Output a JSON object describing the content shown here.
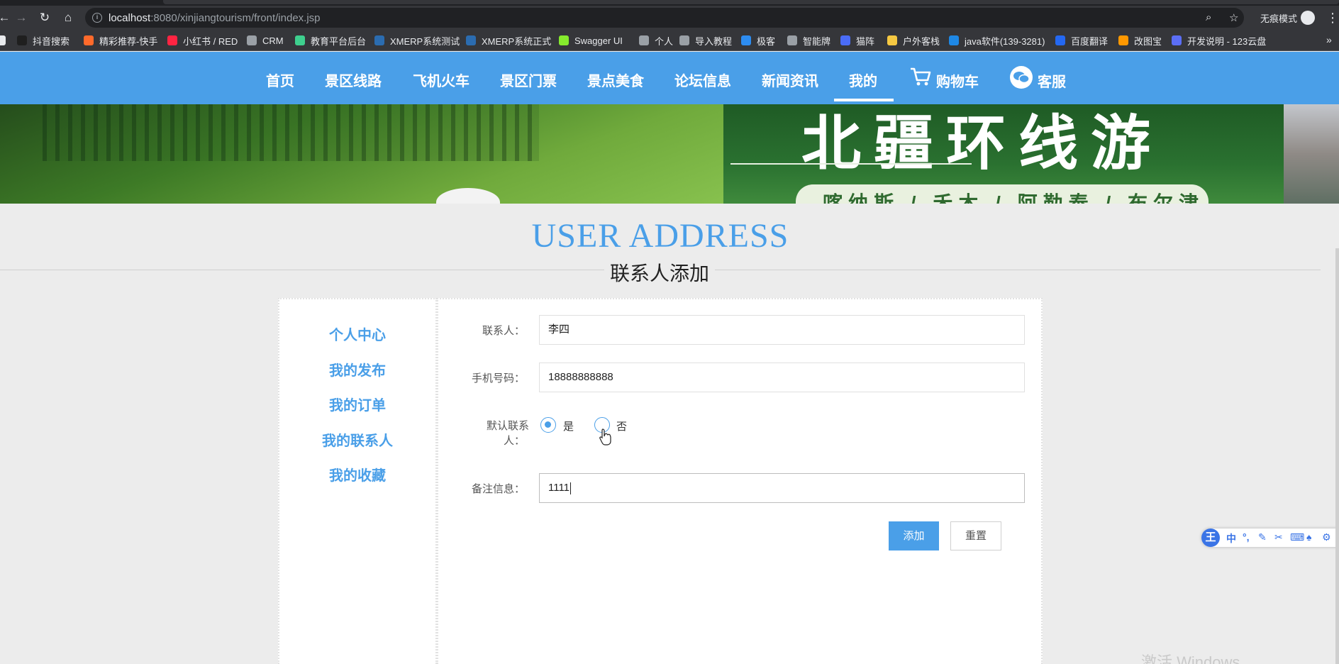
{
  "browser": {
    "url_host": "localhost",
    "url_path": ":8080/xinjiangtourism/front/index.jsp",
    "incognito_label": "无痕模式",
    "bookmarks": [
      {
        "label": "抖音搜索",
        "color": "#1f1f1f"
      },
      {
        "label": "精彩推荐-快手",
        "color": "#ff6a2b"
      },
      {
        "label": "小红书 / RED",
        "color": "#ff2442"
      },
      {
        "label": "CRM",
        "color": "#9aa0a6"
      },
      {
        "label": "教育平台后台",
        "color": "#3ecf8e"
      },
      {
        "label": "XMERP系统测试",
        "color": "#2b6cb0"
      },
      {
        "label": "XMERP系统正式",
        "color": "#2b6cb0"
      },
      {
        "label": "Swagger UI",
        "color": "#85ea2d"
      },
      {
        "label": "个人",
        "color": "#9aa0a6"
      },
      {
        "label": "导入教程",
        "color": "#9aa0a6"
      },
      {
        "label": "极客",
        "color": "#2d8cf0"
      },
      {
        "label": "智能牌",
        "color": "#9aa0a6"
      },
      {
        "label": "猫阵",
        "color": "#4a6cf7"
      },
      {
        "label": "户外客栈",
        "color": "#f5c842"
      },
      {
        "label": "java软件(139-3281)",
        "color": "#1e88e5"
      },
      {
        "label": "百度翻译",
        "color": "#2468f2"
      },
      {
        "label": "改图宝",
        "color": "#ff9800"
      },
      {
        "label": "开发说明 - 123云盘",
        "color": "#5b6ef5"
      }
    ]
  },
  "nav": {
    "items": [
      "首页",
      "景区线路",
      "飞机火车",
      "景区门票",
      "景点美食",
      "论坛信息",
      "新闻资讯",
      "我的"
    ],
    "active": "我的",
    "cart": "购物车",
    "service": "客服"
  },
  "banner": {
    "title": "北疆环线游",
    "subtitle": "喀纳斯 / 禾木 / 阿勒泰 / 布尔津"
  },
  "section": {
    "title_en": "USER ADDRESS",
    "title_cn": "联系人添加"
  },
  "sidebar": {
    "items": [
      "个人中心",
      "我的发布",
      "我的订单",
      "我的联系人",
      "我的收藏"
    ]
  },
  "form": {
    "contact_label": "联系人：",
    "contact_value": "李四",
    "phone_label": "手机号码：",
    "phone_value": "18888888888",
    "default_label_line1": "默认联系",
    "default_label_line2": "人：",
    "default_yes": "是",
    "default_no": "否",
    "default_selected": "是",
    "remark_label": "备注信息：",
    "remark_value": "1111",
    "add_button": "添加",
    "reset_button": "重置"
  },
  "ime": {
    "logo": "王",
    "mode": "中"
  },
  "watermark": "激活 Windows",
  "colors": {
    "primary": "#4a9fe8",
    "background": "#ececec"
  }
}
